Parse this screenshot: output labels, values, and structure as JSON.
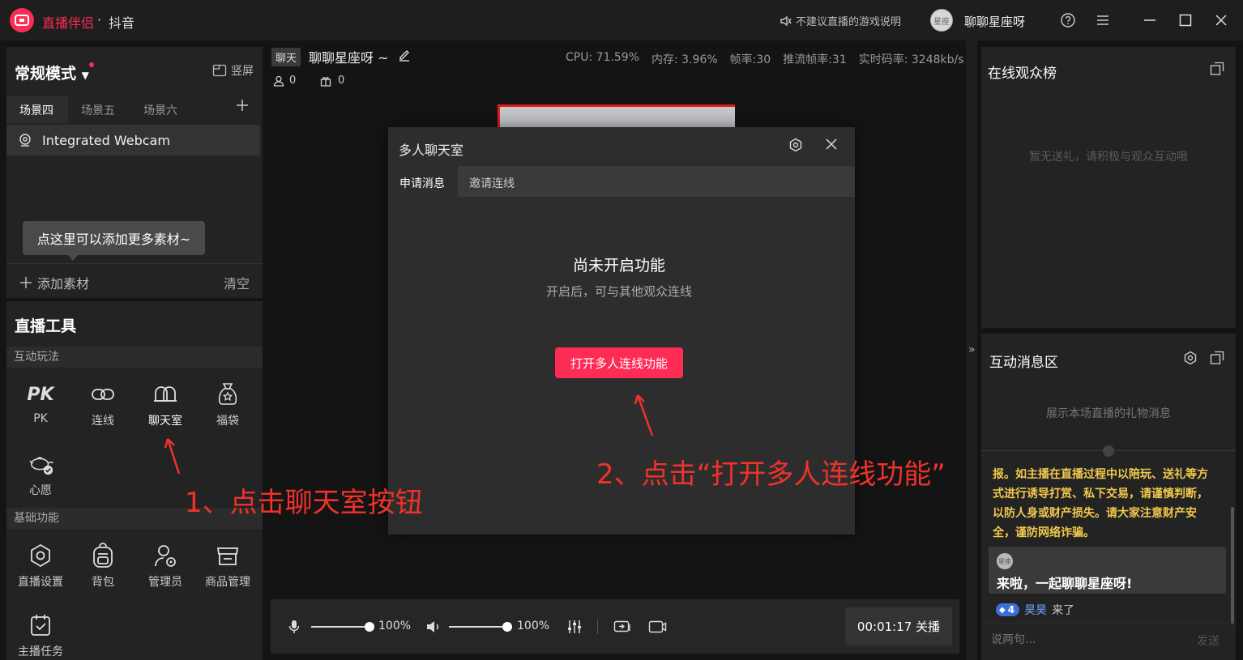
{
  "app": {
    "name": "直播伴侣",
    "separator": "·",
    "platform": "抖音"
  },
  "titlebar": {
    "game_notice": "不建议直播的游戏说明",
    "avatar_text": "星座",
    "username": "聊聊星座呀"
  },
  "left": {
    "mode_title": "常规模式",
    "portrait_label": "竖屏",
    "scenes": [
      "场景四",
      "场景五",
      "场景六"
    ],
    "source_name": "Integrated Webcam",
    "tip": "点这里可以添加更多素材~",
    "add_source": "添加素材",
    "clear": "清空"
  },
  "tools": {
    "title": "直播工具",
    "interactive_section": "互动玩法",
    "interactive": [
      "PK",
      "连线",
      "聊天室",
      "福袋",
      "心愿"
    ],
    "basic_section": "基础功能",
    "basic": [
      "直播设置",
      "背包",
      "管理员",
      "商品管理",
      "主播任务"
    ]
  },
  "stream": {
    "type_badge": "聊天",
    "title": "聊聊星座呀 ~",
    "stats": [
      "CPU: 71.59%",
      "内存: 3.96%",
      "帧率:30",
      "推流帧率:31",
      "实时码率: 3248kb/s"
    ],
    "viewers": "0",
    "gifts": "0"
  },
  "bottom": {
    "mic_volume": "100%",
    "speaker_volume": "100%",
    "end_live": "00:01:17 关播"
  },
  "volume_levels": {
    "mic": 1.0,
    "speaker": 1.0
  },
  "dialog": {
    "title": "多人聊天室",
    "tabs": [
      "申请消息",
      "邀请连线"
    ],
    "disabled_title": "尚未开启功能",
    "disabled_desc": "开启后，可与其他观众连线",
    "enable_button": "打开多人连线功能"
  },
  "annotations": {
    "step1": "1、点击聊天室按钮",
    "step2": "2、点击“打开多人连线功能”"
  },
  "right": {
    "rank_title": "在线观众榜",
    "rank_empty": "暂无送礼，请积极与观众互动哦",
    "msg_title": "互动消息区",
    "gift_hint": "展示本场直播的礼物消息",
    "warning": "报。如主播在直播过程中以陪玩、送礼等方式进行诱导打赏、私下交易，请谨慎判断，以防人身或财产损失。请大家注意财产安全，谨防网络诈骗。",
    "welcome_avatar": "星座",
    "welcome": "来啦，一起聊聊星座呀!",
    "join_level": "4",
    "join_name": "昊昊",
    "join_action": "来了",
    "chat_placeholder": "说两句...",
    "send": "发送"
  },
  "colors": {
    "accent": "#fe2c55",
    "annotation": "#f0322a",
    "warning": "#f2c94c",
    "name_link": "#6aa8ff"
  }
}
